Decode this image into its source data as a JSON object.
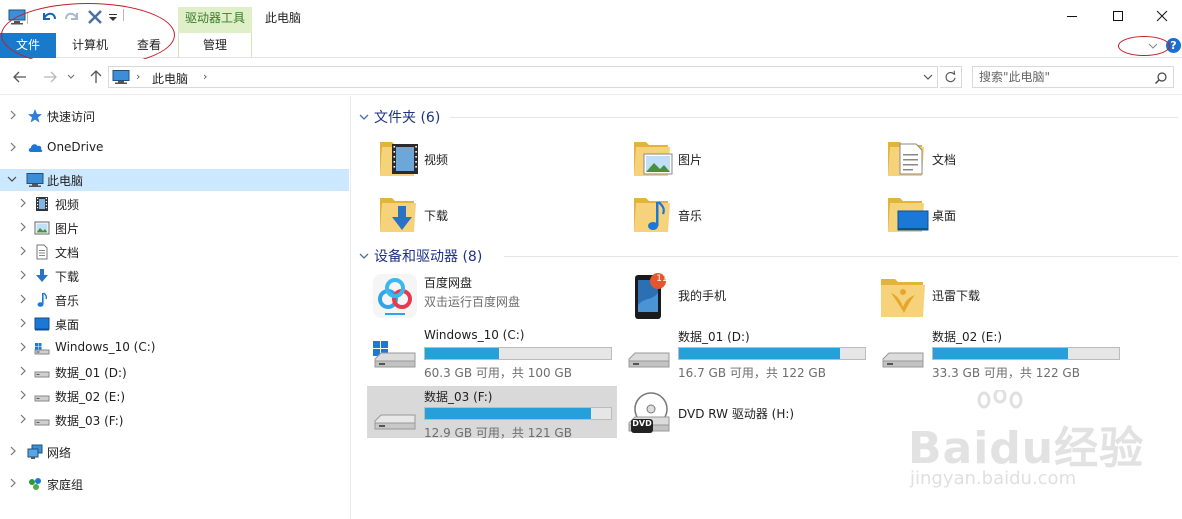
{
  "window": {
    "title": "此电脑",
    "context_tab_header": "驱动器工具"
  },
  "ribbon": {
    "tabs": [
      {
        "label": "文件",
        "active": true
      },
      {
        "label": "计算机"
      },
      {
        "label": "查看"
      },
      {
        "label": "管理"
      }
    ],
    "help_label": "?"
  },
  "addressbar": {
    "path": "此电脑",
    "search_placeholder": "搜索\"此电脑\""
  },
  "navpane": {
    "items": [
      {
        "label": "快速访问",
        "icon": "star-icon"
      },
      {
        "label": "OneDrive",
        "icon": "cloud-icon"
      },
      {
        "label": "此电脑",
        "icon": "computer-icon",
        "selected": true,
        "expanded": true
      },
      {
        "label": "视频",
        "icon": "video-icon"
      },
      {
        "label": "图片",
        "icon": "picture-icon"
      },
      {
        "label": "文档",
        "icon": "document-icon"
      },
      {
        "label": "下载",
        "icon": "download-icon"
      },
      {
        "label": "音乐",
        "icon": "music-icon"
      },
      {
        "label": "桌面",
        "icon": "desktop-icon"
      },
      {
        "label": "Windows_10 (C:)",
        "icon": "system-drive-icon"
      },
      {
        "label": "数据_01 (D:)",
        "icon": "drive-icon"
      },
      {
        "label": "数据_02 (E:)",
        "icon": "drive-icon"
      },
      {
        "label": "数据_03 (F:)",
        "icon": "drive-icon"
      },
      {
        "label": "网络",
        "icon": "network-icon"
      },
      {
        "label": "家庭组",
        "icon": "homegroup-icon"
      }
    ]
  },
  "folders": {
    "header": "文件夹 (6)",
    "items": [
      {
        "label": "视频",
        "icon": "video-folder-icon"
      },
      {
        "label": "图片",
        "icon": "picture-folder-icon"
      },
      {
        "label": "文档",
        "icon": "document-folder-icon"
      },
      {
        "label": "下载",
        "icon": "download-folder-icon"
      },
      {
        "label": "音乐",
        "icon": "music-folder-icon"
      },
      {
        "label": "桌面",
        "icon": "desktop-folder-icon"
      }
    ]
  },
  "devices": {
    "header": "设备和驱动器 (8)",
    "items": [
      {
        "name": "百度网盘",
        "subtitle": "双击运行百度网盘",
        "icon": "baidu-netdisk-icon"
      },
      {
        "name": "我的手机",
        "icon": "phone-icon",
        "badge": "11"
      },
      {
        "name": "迅雷下载",
        "icon": "xunlei-icon"
      },
      {
        "name": "Windows_10 (C:)",
        "free_text": "60.3 GB 可用，共 100 GB",
        "used_fraction": 0.397,
        "icon": "system-drive-icon"
      },
      {
        "name": "数据_01 (D:)",
        "free_text": "16.7 GB 可用，共 122 GB",
        "used_fraction": 0.863,
        "icon": "drive-icon"
      },
      {
        "name": "数据_02 (E:)",
        "free_text": "33.3 GB 可用，共 122 GB",
        "used_fraction": 0.727,
        "icon": "drive-icon"
      },
      {
        "name": "数据_03 (F:)",
        "free_text": "12.9 GB 可用，共 121 GB",
        "used_fraction": 0.893,
        "icon": "drive-icon",
        "selected": true
      },
      {
        "name": "DVD RW 驱动器 (H:)",
        "icon": "dvd-drive-icon",
        "badge": "DVD"
      }
    ]
  },
  "watermark": {
    "logo": "Baidu经验",
    "url": "jingyan.baidu.com"
  },
  "colors": {
    "accent": "#1979ca",
    "selection": "#cce8ff",
    "progress": "#26a0da",
    "header_text": "#1e3287",
    "annotation": "#c0202a"
  }
}
